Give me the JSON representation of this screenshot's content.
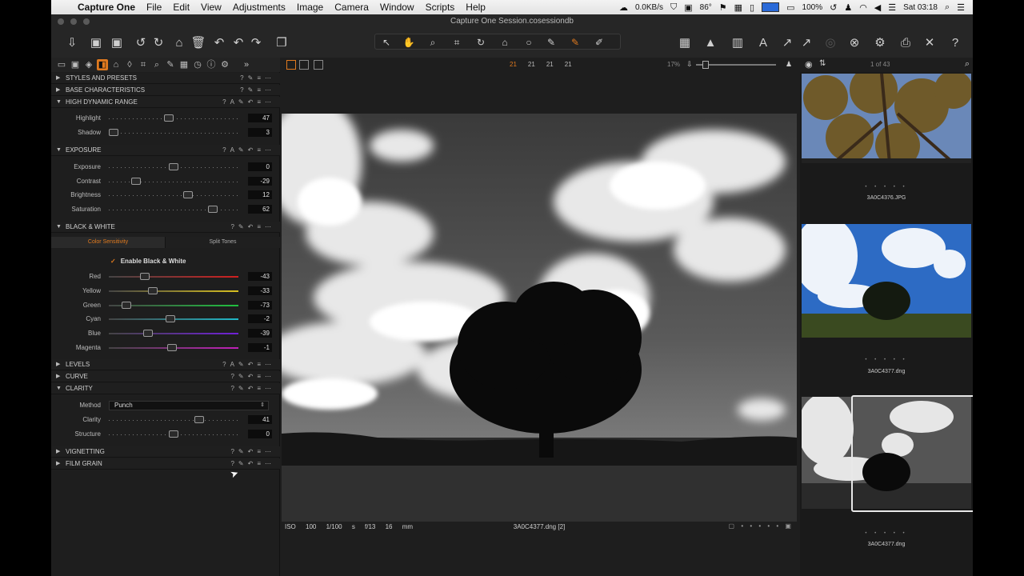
{
  "menubar": {
    "app": "Capture One",
    "items": [
      "File",
      "Edit",
      "View",
      "Adjustments",
      "Image",
      "Camera",
      "Window",
      "Scripts",
      "Help"
    ],
    "net": "0.0KB/s",
    "temp": "86°",
    "battery": "100%",
    "clock": "Sat 03:18"
  },
  "window": {
    "title": "Capture One Session.cosessiondb"
  },
  "left_panel": {
    "styles_presets": "STYLES AND PRESETS",
    "base_characteristics": "BASE CHARACTERISTICS",
    "hdr": {
      "title": "HIGH DYNAMIC RANGE",
      "highlight_label": "Highlight",
      "highlight": "47",
      "shadow_label": "Shadow",
      "shadow": "3"
    },
    "exposure": {
      "title": "EXPOSURE",
      "exposure_label": "Exposure",
      "exposure": "0",
      "contrast_label": "Contrast",
      "contrast": "-29",
      "brightness_label": "Brightness",
      "brightness": "12",
      "saturation_label": "Saturation",
      "saturation": "62"
    },
    "bw": {
      "title": "BLACK & WHITE",
      "tab_color": "Color Sensitivity",
      "tab_split": "Split Tones",
      "enable": "Enable Black & White",
      "red_label": "Red",
      "red": "-43",
      "yellow_label": "Yellow",
      "yellow": "-33",
      "green_label": "Green",
      "green": "-73",
      "cyan_label": "Cyan",
      "cyan": "-2",
      "blue_label": "Blue",
      "blue": "-39",
      "magenta_label": "Magenta",
      "magenta": "-1"
    },
    "levels": "LEVELS",
    "curve": "CURVE",
    "clarity": {
      "title": "CLARITY",
      "method_label": "Method",
      "method": "Punch",
      "clarity_label": "Clarity",
      "clarity": "41",
      "structure_label": "Structure",
      "structure": "0"
    },
    "vignetting": "VIGNETTING",
    "film_grain": "FILM GRAIN"
  },
  "viewer": {
    "counts": [
      "21",
      "21",
      "21",
      "21"
    ],
    "zoom": "17%",
    "exif": "ISO 100  1/100 s  f/13  16 mm",
    "filename": "3A0C4377.dng [2]"
  },
  "browser": {
    "count": "1 of 43",
    "thumbs": [
      {
        "name": "3A0C4376.JPG"
      },
      {
        "name": "3A0C4377.dng"
      },
      {
        "name": "3A0C4377.dng"
      }
    ]
  },
  "colors": {
    "accent": "#e07a1f",
    "panel": "#1e1e1e"
  }
}
